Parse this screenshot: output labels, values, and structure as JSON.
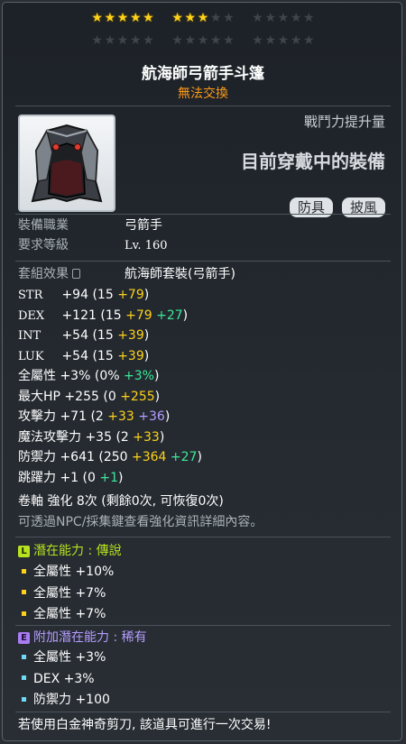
{
  "stars": {
    "filled": 8,
    "total": 30,
    "group_size": 5
  },
  "item": {
    "name": "航海師弓箭手斗篷",
    "trade_status": "無法交換",
    "combat_power_label": "戰鬥力提升量",
    "equipped_label": "目前穿戴中的裝備",
    "tags": [
      "防具",
      "披風"
    ]
  },
  "requirements": {
    "job_label": "裝備職業",
    "job_value": "弓箭手",
    "level_label": "要求等級",
    "level_value": "Lv. 160"
  },
  "set_effect": {
    "label": "套組效果",
    "value": "航海師套裝(弓箭手)"
  },
  "stats": [
    {
      "name": "STR",
      "cjk": false,
      "total": "+94",
      "base": "15",
      "parts": [
        {
          "text": "+79",
          "color": "yellow"
        }
      ]
    },
    {
      "name": "DEX",
      "cjk": false,
      "total": "+121",
      "base": "15",
      "parts": [
        {
          "text": "+79",
          "color": "yellow"
        },
        {
          "text": "+27",
          "color": "green"
        }
      ]
    },
    {
      "name": "INT",
      "cjk": false,
      "total": "+54",
      "base": "15",
      "parts": [
        {
          "text": "+39",
          "color": "yellow"
        }
      ]
    },
    {
      "name": "LUK",
      "cjk": false,
      "total": "+54",
      "base": "15",
      "parts": [
        {
          "text": "+39",
          "color": "yellow"
        }
      ]
    },
    {
      "name": "全屬性",
      "cjk": true,
      "total": "+3%",
      "base": "0%",
      "parts": [
        {
          "text": "+3%",
          "color": "green"
        }
      ]
    },
    {
      "name": "最大HP",
      "cjk": true,
      "total": "+255",
      "base": "0",
      "parts": [
        {
          "text": "+255",
          "color": "yellow"
        }
      ]
    },
    {
      "name": "攻擊力",
      "cjk": true,
      "total": "+71",
      "base": "2",
      "parts": [
        {
          "text": "+33",
          "color": "yellow"
        },
        {
          "text": "+36",
          "color": "purple"
        }
      ]
    },
    {
      "name": "魔法攻擊力",
      "cjk": true,
      "total": "+35",
      "base": "2",
      "parts": [
        {
          "text": "+33",
          "color": "yellow"
        }
      ]
    },
    {
      "name": "防禦力",
      "cjk": true,
      "total": "+641",
      "base": "250",
      "parts": [
        {
          "text": "+364",
          "color": "yellow"
        },
        {
          "text": "+27",
          "color": "green"
        }
      ]
    },
    {
      "name": "跳躍力",
      "cjk": true,
      "total": "+1",
      "base": "0",
      "parts": [
        {
          "text": "+1",
          "color": "green"
        }
      ]
    }
  ],
  "scroll": {
    "text": "卷軸 強化 8次 (剩餘0次, 可恢復0次)",
    "hint": "可透過NPC/採集鍵查看強化資訊詳細內容。"
  },
  "potential": {
    "badge": "L",
    "label": "潛在能力",
    "grade": "傳說",
    "lines": [
      "全屬性 +10%",
      "全屬性 +7%",
      "全屬性 +7%"
    ]
  },
  "additional_potential": {
    "badge": "E",
    "label": "附加潛在能力",
    "grade": "稀有",
    "lines": [
      "全屬性 +3%",
      "DEX +3%",
      "防禦力 +100"
    ]
  },
  "footer": "若使用白金神奇剪刀, 該道具可進行一次交易!",
  "colors": {
    "star_on": "#ffd21a",
    "trade": "#ff9a1a",
    "legend": "#b7e21f",
    "epic": "#a97cf2",
    "bonus_yellow": "#ffd21a",
    "bonus_green": "#3ee89a",
    "bonus_purple": "#b59cff"
  }
}
